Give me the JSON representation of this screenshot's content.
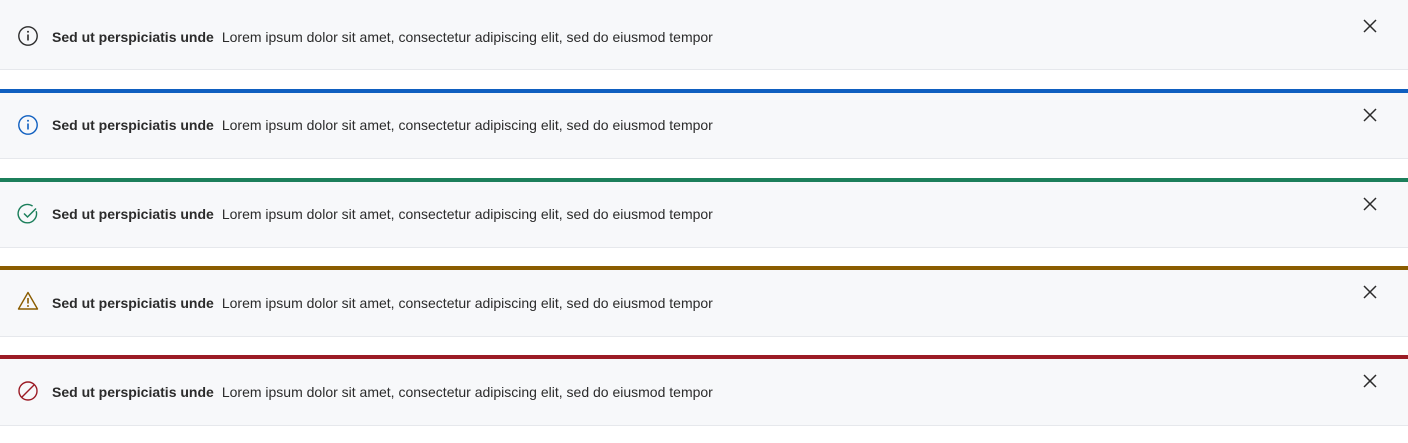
{
  "alerts": [
    {
      "variant": "neutral",
      "icon": "info-icon",
      "color": "#2b2b2b",
      "title": "Sed ut perspiciatis unde",
      "message": "Lorem ipsum dolor sit amet, consectetur adipiscing elit, sed do eiusmod tempor",
      "close_icon": "close-icon"
    },
    {
      "variant": "info",
      "icon": "info-icon",
      "color": "#0f5fc0",
      "title": "Sed ut perspiciatis unde",
      "message": "Lorem ipsum dolor sit amet, consectetur adipiscing elit, sed do eiusmod tempor",
      "close_icon": "close-icon"
    },
    {
      "variant": "success",
      "icon": "check-circle-icon",
      "color": "#1c7f5b",
      "title": "Sed ut perspiciatis unde",
      "message": "Lorem ipsum dolor sit amet, consectetur adipiscing elit, sed do eiusmod tempor",
      "close_icon": "close-icon"
    },
    {
      "variant": "warning",
      "icon": "warning-triangle-icon",
      "color": "#8a5c00",
      "title": "Sed ut perspiciatis unde",
      "message": "Lorem ipsum dolor sit amet, consectetur adipiscing elit, sed do eiusmod tempor",
      "close_icon": "close-icon"
    },
    {
      "variant": "error",
      "icon": "prohibited-icon",
      "color": "#9b1b25",
      "title": "Sed ut perspiciatis unde",
      "message": "Lorem ipsum dolor sit amet, consectetur adipiscing elit, sed do eiusmod tempor",
      "close_icon": "close-icon"
    }
  ]
}
